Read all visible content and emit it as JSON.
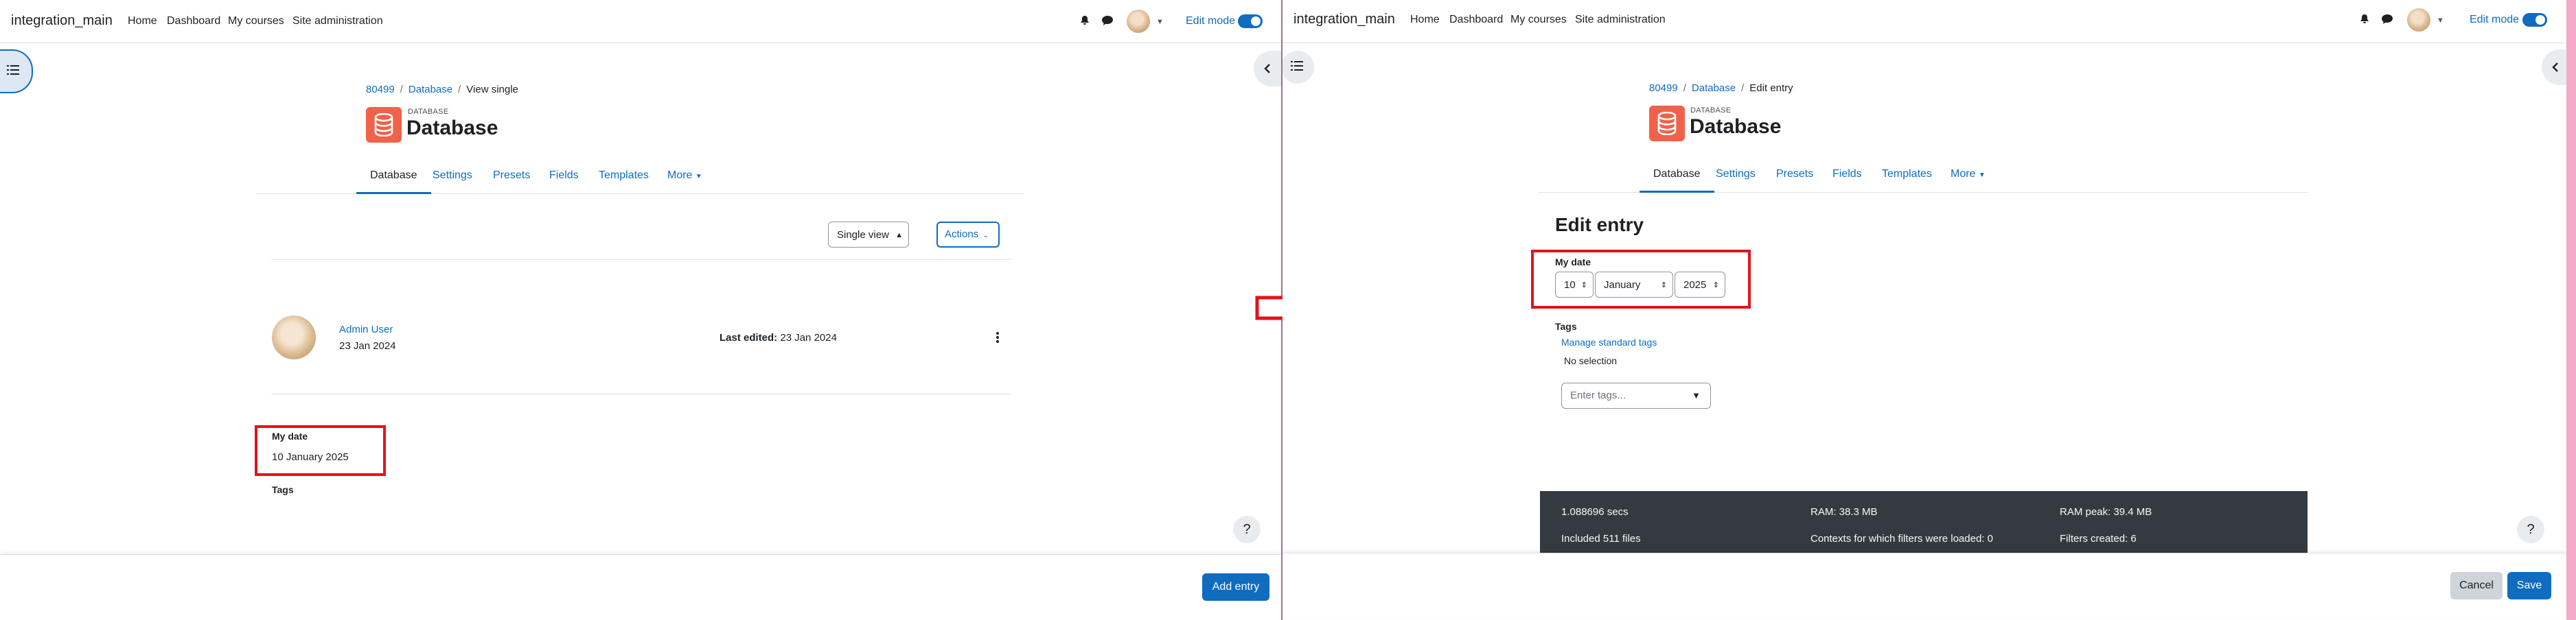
{
  "colors": {
    "brand": "#0f6cbf",
    "annotation": "#e0141e",
    "db_icon": "#f0624a",
    "perf_bg": "#343a40"
  },
  "left": {
    "navbar": {
      "site_name": "integration_main",
      "links": [
        "Home",
        "Dashboard",
        "My courses",
        "Site administration"
      ],
      "edit_mode": "Edit mode"
    },
    "breadcrumb": {
      "course": "80499",
      "activity": "Database",
      "current": "View single"
    },
    "header": {
      "module_type": "DATABASE",
      "title": "Database"
    },
    "tabs": [
      "Database",
      "Settings",
      "Presets",
      "Fields",
      "Templates",
      "More"
    ],
    "view_select": "Single view",
    "actions": "Actions",
    "entry": {
      "author": "Admin User",
      "date": "23 Jan 2024",
      "last_edited_label": "Last edited:",
      "last_edited_value": "23 Jan 2024",
      "field_label": "My date",
      "field_value": "10 January 2025",
      "tags_label": "Tags"
    },
    "help": "?",
    "footer": {
      "add_entry": "Add entry"
    }
  },
  "right": {
    "navbar": {
      "site_name": "integration_main",
      "links": [
        "Home",
        "Dashboard",
        "My courses",
        "Site administration"
      ],
      "edit_mode": "Edit mode"
    },
    "breadcrumb": {
      "course": "80499",
      "activity": "Database",
      "current": "Edit entry"
    },
    "header": {
      "module_type": "DATABASE",
      "title": "Database"
    },
    "tabs": [
      "Database",
      "Settings",
      "Presets",
      "Fields",
      "Templates",
      "More"
    ],
    "form": {
      "heading": "Edit entry",
      "field_label": "My date",
      "day": "10",
      "month": "January",
      "year": "2025",
      "tags_label": "Tags",
      "manage_tags": "Manage standard tags",
      "no_selection": "No selection",
      "tags_placeholder": "Enter tags..."
    },
    "perf": {
      "secs": "1.088696 secs",
      "ram": "RAM: 38.3 MB",
      "ram_peak": "RAM peak: 39.4 MB",
      "files": "Included 511 files",
      "contexts": "Contexts for which filters were loaded: 0",
      "filters": "Filters created: 6"
    },
    "help": "?",
    "footer": {
      "cancel": "Cancel",
      "save": "Save"
    }
  }
}
